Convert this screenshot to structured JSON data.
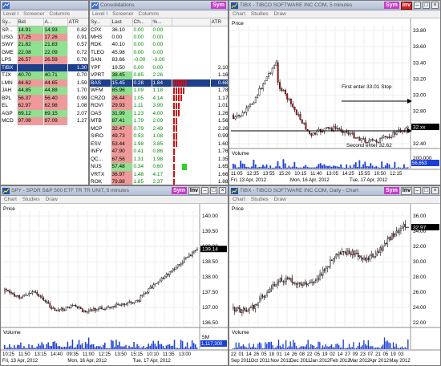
{
  "w1": {
    "tabs": [
      "Level I",
      "Screener",
      "Columns"
    ],
    "headers": [
      "Sy...",
      "Bid",
      "A...",
      "ATR"
    ],
    "rows": [
      {
        "s": "SP...",
        "b": "14.91",
        "a": "14.93",
        "atr": "0.82",
        "c": "g"
      },
      {
        "s": "USG",
        "b": "17.25",
        "a": "17.26",
        "atr": "0.91",
        "c": "r"
      },
      {
        "s": "SWY",
        "b": "21.82",
        "a": "21.83",
        "atr": "0.57",
        "c": "g"
      },
      {
        "s": "GME",
        "b": "22.08",
        "a": "22.09",
        "atr": "0.72",
        "c": "g"
      },
      {
        "s": "LPS",
        "b": "26.57",
        "a": "26.59",
        "atr": "0.76",
        "c": "r"
      },
      {
        "s": "TIBX",
        "b": "",
        "a": "",
        "atr": "1.30",
        "c": "sel"
      },
      {
        "s": "TJX",
        "b": "40.70",
        "a": "40.71",
        "atr": "0.70",
        "c": "g"
      },
      {
        "s": "LMN",
        "b": "44.62",
        "a": "44.65",
        "atr": "1.59",
        "c": "r"
      },
      {
        "s": "JAH",
        "b": "44.85",
        "a": "44.88",
        "atr": "1.70",
        "c": "g"
      },
      {
        "s": "BPL",
        "b": "56.37",
        "a": "56.40",
        "atr": "0.99",
        "c": "r"
      },
      {
        "s": "EL",
        "b": "62.97",
        "a": "62.98",
        "atr": "1.08",
        "c": "r"
      },
      {
        "s": "AGP",
        "b": "69.12",
        "a": "69.15",
        "atr": "2.07",
        "c": "g"
      },
      {
        "s": "MCD",
        "b": "97.08",
        "a": "97.09",
        "atr": "1.27",
        "c": "r"
      }
    ]
  },
  "w2": {
    "title": "Consolidations",
    "badge": "Sym",
    "tabs": [
      "Level I",
      "Screener",
      "Columns"
    ],
    "headers": [
      "Sy...",
      "Last",
      "Ch...",
      "%...",
      "",
      "ATR"
    ],
    "rows": [
      {
        "s": "CPX",
        "l": "36.10",
        "ch": "0.00",
        "p": "0.00",
        "atr": "",
        "c": "",
        "bar": 0
      },
      {
        "s": "MHS",
        "l": "0.00",
        "ch": "0.00",
        "p": "0.00",
        "atr": "",
        "c": "",
        "bar": 0
      },
      {
        "s": "RDK",
        "l": "40.10",
        "ch": "0.00",
        "p": "0.00",
        "atr": "",
        "c": "",
        "bar": 0
      },
      {
        "s": "TLEO",
        "l": "45.98",
        "ch": "0.00",
        "p": "0.00",
        "atr": "",
        "c": "",
        "bar": 0
      },
      {
        "s": "SAN",
        "l": "83.66",
        "ch": "-0.00",
        "p": "-0.00",
        "atr": "",
        "c": "",
        "bar": 0
      },
      {
        "s": "YPF",
        "l": "19.50",
        "ch": "0.00",
        "p": "0.00",
        "atr": "2.10",
        "c": "",
        "bar": 0
      },
      {
        "s": "VPRT",
        "l": "38.45",
        "ch": "0.85",
        "p": "2.26",
        "atr": "1.16",
        "c": "g",
        "bar": 0
      },
      {
        "s": "BAS",
        "l": "15.45",
        "ch": "0.28",
        "p": "1.84",
        "atr": "0.68",
        "c": "sel",
        "bar": 6
      },
      {
        "s": "WFM",
        "l": "85.96",
        "ch": "1.09",
        "p": "1.18",
        "atr": "1.78",
        "c": "g",
        "bar": 5
      },
      {
        "s": "CRZO",
        "l": "26.44",
        "ch": "1.05",
        "p": "4.14",
        "atr": "1.17",
        "c": "r",
        "bar": 4
      },
      {
        "s": "ROVI",
        "l": "29.93",
        "ch": "1.11",
        "p": "3.90",
        "atr": "1.01",
        "c": "r",
        "bar": 3
      },
      {
        "s": "OAS",
        "l": "31.99",
        "ch": "1.23",
        "p": "4.00",
        "atr": "1.26",
        "c": "g",
        "bar": 3
      },
      {
        "s": "MTB",
        "l": "87.41",
        "ch": "1.79",
        "p": "2.09",
        "atr": "1.56",
        "c": "g",
        "bar": 2
      },
      {
        "s": "MCP",
        "l": "32.47",
        "ch": "0.79",
        "p": "2.49",
        "atr": "2.26",
        "c": "r",
        "bar": 2
      },
      {
        "s": "SIRO",
        "l": "49.73",
        "ch": "0.53",
        "p": "1.08",
        "atr": "0.99",
        "c": "r",
        "bar": 2
      },
      {
        "s": "ESV",
        "l": "53.44",
        "ch": "1.98",
        "p": "3.85",
        "atr": "1.60",
        "c": "r",
        "bar": 2
      },
      {
        "s": "INFY",
        "l": "47.90",
        "ch": "0.41",
        "p": "0.86",
        "atr": "1.76",
        "c": "r",
        "bar": 1
      },
      {
        "s": "QC...",
        "l": "67.56",
        "ch": "1.31",
        "p": "1.98",
        "atr": "1.35",
        "c": "r",
        "bar": 1
      },
      {
        "s": "NUS",
        "l": "57.48",
        "ch": "0.34",
        "p": "0.60",
        "atr": "1.65",
        "c": "g",
        "bar": 1
      },
      {
        "s": "VRTX",
        "l": "36.97",
        "ch": "1.48",
        "p": "4.17",
        "atr": "1.66",
        "c": "r",
        "bar": 1
      },
      {
        "s": "ROK",
        "l": "79.88",
        "ch": "1.85",
        "p": "2.37",
        "atr": "1.88",
        "c": "r",
        "bar": 1
      },
      {
        "s": "SCSS",
        "l": "34.62",
        "ch": "0.37",
        "p": "1.08",
        "atr": "1.25",
        "c": "r",
        "bar": 1
      },
      {
        "s": "JAZZ",
        "l": "44.86",
        "ch": "0.11",
        "p": "0.25",
        "atr": "1.79",
        "c": "r",
        "bar": 1
      }
    ]
  },
  "c1": {
    "title": "TIBX - TIBCO SOFTWARE INC COM, 5 minutes",
    "badge": "Sym",
    "inv": "Inv",
    "menu": [
      "Chart",
      "Studies",
      "Draw"
    ],
    "price_label": "Price",
    "volume_label": "Volume",
    "annotations": [
      "First enter 33.01 Stop",
      "Second enter 32.62"
    ],
    "price_ticks": [
      "33.80",
      "33.60",
      "33.40",
      "33.20",
      "33.00",
      "32.80",
      "32.60",
      "32.40"
    ],
    "current_price": "32.xx",
    "volume_ticks": [
      "200,000",
      "56,653"
    ],
    "time_ticks": [
      "11:05",
      "12:35",
      "13:55",
      "15:20",
      "10:15",
      "11:40",
      "13:05",
      "14:25",
      "15:55",
      "10:50",
      "12:15"
    ],
    "date_ticks": [
      "Fri, 13 Apr, 2012",
      "Mon, 16 Apr, 2012",
      "Tue, 17 Apr, 2012"
    ]
  },
  "c2": {
    "title": "SPY - SPDR S&P 500 ETF TR TR UNIT, 5 minutes",
    "badge": "Sym",
    "inv": "Inv",
    "menu": [
      "Chart",
      "Studies",
      "Draw"
    ],
    "price_label": "Price",
    "volume_label": "Volume",
    "price_ticks": [
      "140.00",
      "139.50",
      "139.00",
      "138.50",
      "138.00",
      "137.50",
      "137.00",
      "136.50"
    ],
    "current_price": "139.14",
    "volume_ticks": [
      "5M",
      "1,117,300"
    ],
    "time_ticks": [
      "10:25",
      "11:50",
      "13:15",
      "14:40",
      "09:35",
      "11:00",
      "12:25",
      "13:50",
      "15:15",
      "10:10",
      "11:35",
      "13:00"
    ],
    "date_ticks": [
      "Fri, 13 Apr, 2012",
      "Mon, 16 Apr, 2012",
      "Tue, 17 Apr, 2012"
    ]
  },
  "c3": {
    "title": "TIBX - TIBCO SOFTWARE INC COM, Daily - Chart",
    "badge": "Sym",
    "inv": "Inv",
    "menu": [
      "Chart",
      "Studies",
      "Draw"
    ],
    "price_label": "Price",
    "volume_label": "Volume",
    "price_ticks": [
      "36.00",
      "34.00",
      "32.00",
      "30.00",
      "28.00",
      "26.00",
      "24.00",
      "22.00"
    ],
    "current_price": "32.97",
    "time_ticks": [
      "22",
      "01",
      "14",
      "26",
      "05",
      "18",
      "01",
      "14",
      "26",
      "08",
      "22",
      "05",
      "19",
      "02",
      "14",
      "27",
      "09",
      "23",
      "07",
      "21",
      "05",
      "19",
      "03"
    ],
    "date_ticks": [
      "Sep 2011",
      "Oct 2011",
      "Nov 2011",
      "Dec 2011",
      "Jan 2012",
      "Feb 2012",
      "Mar 2012",
      "Apr 2012",
      "May 2012"
    ]
  },
  "colors": {
    "up": "#ffffff",
    "down": "#d01010",
    "vol": "#1b3fd8",
    "sel": "#1d3f8c"
  }
}
